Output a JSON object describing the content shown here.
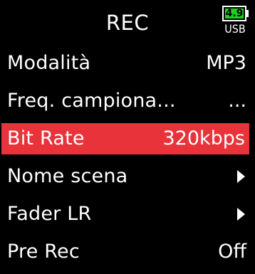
{
  "header": {
    "title": "REC",
    "battery_level": "4.9",
    "power_source": "USB",
    "battery_color": "#1fd11f"
  },
  "menu": {
    "selected_color": "#e8333a",
    "items": [
      {
        "label": "Modalità",
        "value": "MP3",
        "selected": false
      },
      {
        "label": "Freq. campiona...",
        "value": "...",
        "selected": false
      },
      {
        "label": "Bit Rate",
        "value": "320kbps",
        "selected": true
      },
      {
        "label": "Nome scena",
        "icon": "right-arrow-icon",
        "selected": false
      },
      {
        "label": "Fader LR",
        "icon": "right-arrow-icon",
        "selected": false
      },
      {
        "label": "Pre Rec",
        "value": "Off",
        "selected": false
      }
    ]
  }
}
